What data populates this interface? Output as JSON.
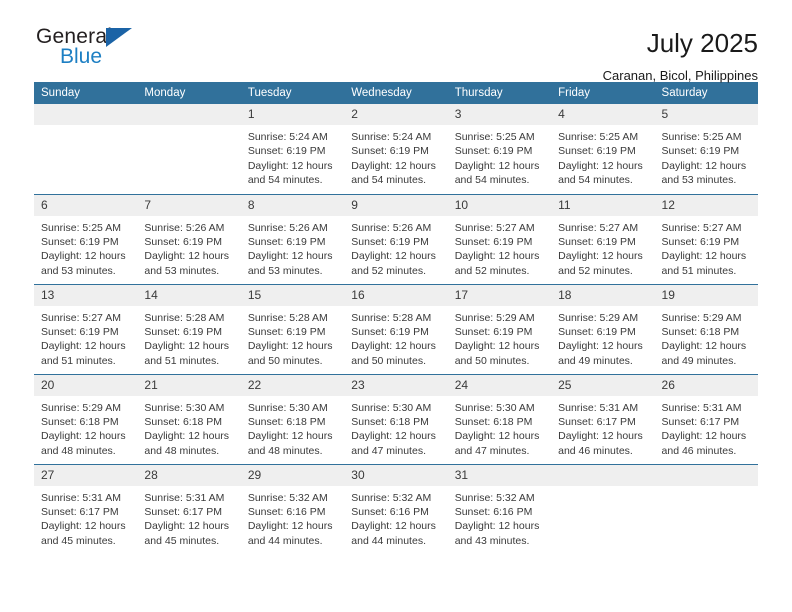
{
  "brand": {
    "name_part1": "General",
    "name_part2": "Blue",
    "accent_color": "#1d7fc3",
    "triangle_color": "#1b63a6",
    "triangle_icon": "triangle-icon"
  },
  "header": {
    "title": "July 2025",
    "subtitle": "Caranan, Bicol, Philippines",
    "header_bg_color": "#31719b",
    "header_text_color": "#ffffff"
  },
  "weekdays": [
    "Sunday",
    "Monday",
    "Tuesday",
    "Wednesday",
    "Thursday",
    "Friday",
    "Saturday"
  ],
  "labels": {
    "sunrise_prefix": "Sunrise:",
    "sunset_prefix": "Sunset:",
    "daylight_prefix": "Daylight:"
  },
  "weeks": [
    [
      {
        "day": "",
        "empty": true
      },
      {
        "day": "",
        "empty": true
      },
      {
        "day": "1",
        "sunrise": "Sunrise: 5:24 AM",
        "sunset": "Sunset: 6:19 PM",
        "daylight_line1": "Daylight: 12 hours",
        "daylight_line2": "and 54 minutes."
      },
      {
        "day": "2",
        "sunrise": "Sunrise: 5:24 AM",
        "sunset": "Sunset: 6:19 PM",
        "daylight_line1": "Daylight: 12 hours",
        "daylight_line2": "and 54 minutes."
      },
      {
        "day": "3",
        "sunrise": "Sunrise: 5:25 AM",
        "sunset": "Sunset: 6:19 PM",
        "daylight_line1": "Daylight: 12 hours",
        "daylight_line2": "and 54 minutes."
      },
      {
        "day": "4",
        "sunrise": "Sunrise: 5:25 AM",
        "sunset": "Sunset: 6:19 PM",
        "daylight_line1": "Daylight: 12 hours",
        "daylight_line2": "and 54 minutes."
      },
      {
        "day": "5",
        "sunrise": "Sunrise: 5:25 AM",
        "sunset": "Sunset: 6:19 PM",
        "daylight_line1": "Daylight: 12 hours",
        "daylight_line2": "and 53 minutes."
      }
    ],
    [
      {
        "day": "6",
        "sunrise": "Sunrise: 5:25 AM",
        "sunset": "Sunset: 6:19 PM",
        "daylight_line1": "Daylight: 12 hours",
        "daylight_line2": "and 53 minutes."
      },
      {
        "day": "7",
        "sunrise": "Sunrise: 5:26 AM",
        "sunset": "Sunset: 6:19 PM",
        "daylight_line1": "Daylight: 12 hours",
        "daylight_line2": "and 53 minutes."
      },
      {
        "day": "8",
        "sunrise": "Sunrise: 5:26 AM",
        "sunset": "Sunset: 6:19 PM",
        "daylight_line1": "Daylight: 12 hours",
        "daylight_line2": "and 53 minutes."
      },
      {
        "day": "9",
        "sunrise": "Sunrise: 5:26 AM",
        "sunset": "Sunset: 6:19 PM",
        "daylight_line1": "Daylight: 12 hours",
        "daylight_line2": "and 52 minutes."
      },
      {
        "day": "10",
        "sunrise": "Sunrise: 5:27 AM",
        "sunset": "Sunset: 6:19 PM",
        "daylight_line1": "Daylight: 12 hours",
        "daylight_line2": "and 52 minutes."
      },
      {
        "day": "11",
        "sunrise": "Sunrise: 5:27 AM",
        "sunset": "Sunset: 6:19 PM",
        "daylight_line1": "Daylight: 12 hours",
        "daylight_line2": "and 52 minutes."
      },
      {
        "day": "12",
        "sunrise": "Sunrise: 5:27 AM",
        "sunset": "Sunset: 6:19 PM",
        "daylight_line1": "Daylight: 12 hours",
        "daylight_line2": "and 51 minutes."
      }
    ],
    [
      {
        "day": "13",
        "sunrise": "Sunrise: 5:27 AM",
        "sunset": "Sunset: 6:19 PM",
        "daylight_line1": "Daylight: 12 hours",
        "daylight_line2": "and 51 minutes."
      },
      {
        "day": "14",
        "sunrise": "Sunrise: 5:28 AM",
        "sunset": "Sunset: 6:19 PM",
        "daylight_line1": "Daylight: 12 hours",
        "daylight_line2": "and 51 minutes."
      },
      {
        "day": "15",
        "sunrise": "Sunrise: 5:28 AM",
        "sunset": "Sunset: 6:19 PM",
        "daylight_line1": "Daylight: 12 hours",
        "daylight_line2": "and 50 minutes."
      },
      {
        "day": "16",
        "sunrise": "Sunrise: 5:28 AM",
        "sunset": "Sunset: 6:19 PM",
        "daylight_line1": "Daylight: 12 hours",
        "daylight_line2": "and 50 minutes."
      },
      {
        "day": "17",
        "sunrise": "Sunrise: 5:29 AM",
        "sunset": "Sunset: 6:19 PM",
        "daylight_line1": "Daylight: 12 hours",
        "daylight_line2": "and 50 minutes."
      },
      {
        "day": "18",
        "sunrise": "Sunrise: 5:29 AM",
        "sunset": "Sunset: 6:19 PM",
        "daylight_line1": "Daylight: 12 hours",
        "daylight_line2": "and 49 minutes."
      },
      {
        "day": "19",
        "sunrise": "Sunrise: 5:29 AM",
        "sunset": "Sunset: 6:18 PM",
        "daylight_line1": "Daylight: 12 hours",
        "daylight_line2": "and 49 minutes."
      }
    ],
    [
      {
        "day": "20",
        "sunrise": "Sunrise: 5:29 AM",
        "sunset": "Sunset: 6:18 PM",
        "daylight_line1": "Daylight: 12 hours",
        "daylight_line2": "and 48 minutes."
      },
      {
        "day": "21",
        "sunrise": "Sunrise: 5:30 AM",
        "sunset": "Sunset: 6:18 PM",
        "daylight_line1": "Daylight: 12 hours",
        "daylight_line2": "and 48 minutes."
      },
      {
        "day": "22",
        "sunrise": "Sunrise: 5:30 AM",
        "sunset": "Sunset: 6:18 PM",
        "daylight_line1": "Daylight: 12 hours",
        "daylight_line2": "and 48 minutes."
      },
      {
        "day": "23",
        "sunrise": "Sunrise: 5:30 AM",
        "sunset": "Sunset: 6:18 PM",
        "daylight_line1": "Daylight: 12 hours",
        "daylight_line2": "and 47 minutes."
      },
      {
        "day": "24",
        "sunrise": "Sunrise: 5:30 AM",
        "sunset": "Sunset: 6:18 PM",
        "daylight_line1": "Daylight: 12 hours",
        "daylight_line2": "and 47 minutes."
      },
      {
        "day": "25",
        "sunrise": "Sunrise: 5:31 AM",
        "sunset": "Sunset: 6:17 PM",
        "daylight_line1": "Daylight: 12 hours",
        "daylight_line2": "and 46 minutes."
      },
      {
        "day": "26",
        "sunrise": "Sunrise: 5:31 AM",
        "sunset": "Sunset: 6:17 PM",
        "daylight_line1": "Daylight: 12 hours",
        "daylight_line2": "and 46 minutes."
      }
    ],
    [
      {
        "day": "27",
        "sunrise": "Sunrise: 5:31 AM",
        "sunset": "Sunset: 6:17 PM",
        "daylight_line1": "Daylight: 12 hours",
        "daylight_line2": "and 45 minutes."
      },
      {
        "day": "28",
        "sunrise": "Sunrise: 5:31 AM",
        "sunset": "Sunset: 6:17 PM",
        "daylight_line1": "Daylight: 12 hours",
        "daylight_line2": "and 45 minutes."
      },
      {
        "day": "29",
        "sunrise": "Sunrise: 5:32 AM",
        "sunset": "Sunset: 6:16 PM",
        "daylight_line1": "Daylight: 12 hours",
        "daylight_line2": "and 44 minutes."
      },
      {
        "day": "30",
        "sunrise": "Sunrise: 5:32 AM",
        "sunset": "Sunset: 6:16 PM",
        "daylight_line1": "Daylight: 12 hours",
        "daylight_line2": "and 44 minutes."
      },
      {
        "day": "31",
        "sunrise": "Sunrise: 5:32 AM",
        "sunset": "Sunset: 6:16 PM",
        "daylight_line1": "Daylight: 12 hours",
        "daylight_line2": "and 43 minutes."
      },
      {
        "day": "",
        "empty": true
      },
      {
        "day": "",
        "empty": true
      }
    ]
  ]
}
